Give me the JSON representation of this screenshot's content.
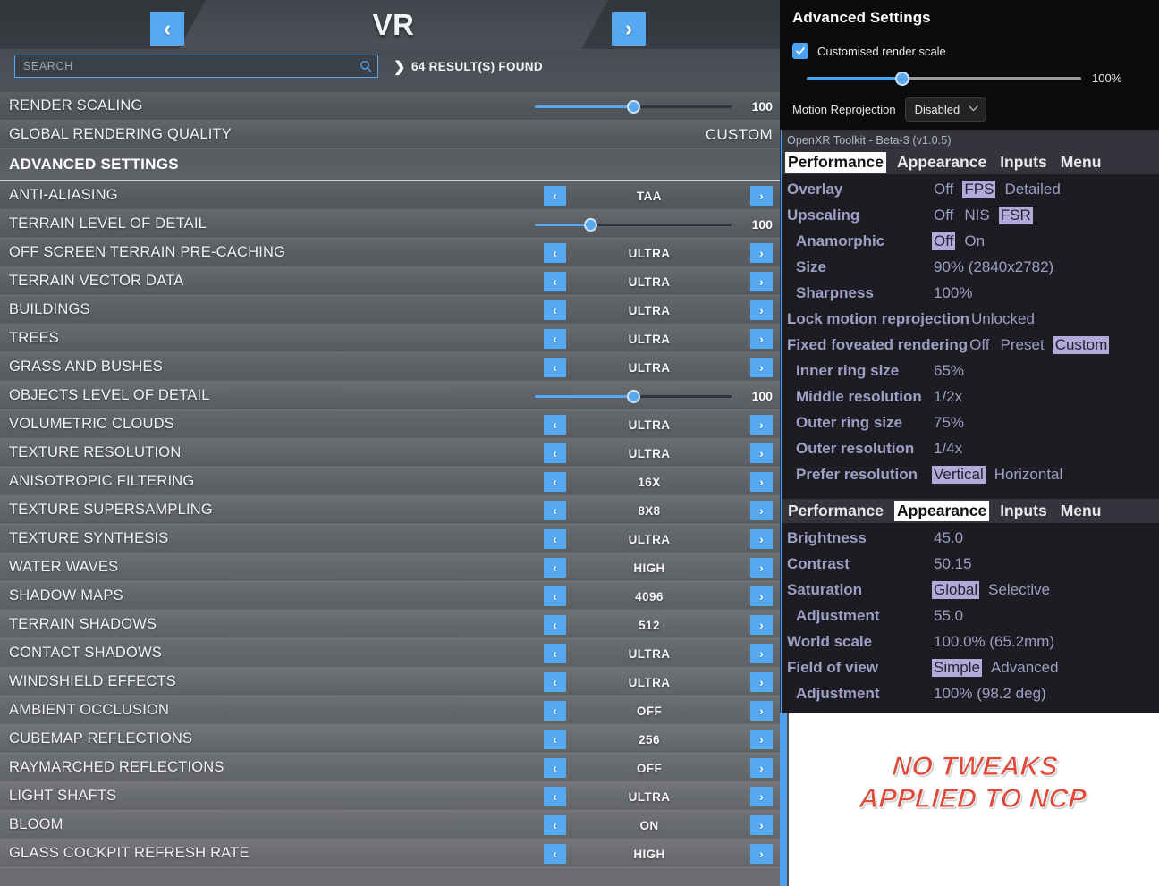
{
  "msfs": {
    "title": "VR",
    "nav": {
      "prev": "‹",
      "next": "›"
    },
    "search": {
      "placeholder": "SEARCH",
      "value": "",
      "icon": "search-icon"
    },
    "results": {
      "arrow": "❯",
      "text": "64 RESULT(S) FOUND"
    },
    "section_header": "ADVANCED SETTINGS",
    "top_rows": [
      {
        "label": "RENDER SCALING",
        "type": "slider",
        "value": "100",
        "fill_pct": 50
      },
      {
        "label": "GLOBAL RENDERING QUALITY",
        "type": "text",
        "value": "CUSTOM"
      }
    ],
    "rows": [
      {
        "label": "ANTI-ALIASING",
        "type": "spinner",
        "value": "TAA"
      },
      {
        "label": "TERRAIN LEVEL OF DETAIL",
        "type": "slider",
        "value": "100",
        "fill_pct": 28
      },
      {
        "label": "OFF SCREEN TERRAIN PRE-CACHING",
        "type": "spinner",
        "value": "ULTRA"
      },
      {
        "label": "TERRAIN VECTOR DATA",
        "type": "spinner",
        "value": "ULTRA"
      },
      {
        "label": "BUILDINGS",
        "type": "spinner",
        "value": "ULTRA"
      },
      {
        "label": "TREES",
        "type": "spinner",
        "value": "ULTRA"
      },
      {
        "label": "GRASS AND BUSHES",
        "type": "spinner",
        "value": "ULTRA"
      },
      {
        "label": "OBJECTS LEVEL OF DETAIL",
        "type": "slider",
        "value": "100",
        "fill_pct": 50
      },
      {
        "label": "VOLUMETRIC CLOUDS",
        "type": "spinner",
        "value": "ULTRA"
      },
      {
        "label": "TEXTURE RESOLUTION",
        "type": "spinner",
        "value": "ULTRA"
      },
      {
        "label": "ANISOTROPIC FILTERING",
        "type": "spinner",
        "value": "16X"
      },
      {
        "label": "TEXTURE SUPERSAMPLING",
        "type": "spinner",
        "value": "8X8"
      },
      {
        "label": "TEXTURE SYNTHESIS",
        "type": "spinner",
        "value": "ULTRA"
      },
      {
        "label": "WATER WAVES",
        "type": "spinner",
        "value": "HIGH"
      },
      {
        "label": "SHADOW MAPS",
        "type": "spinner",
        "value": "4096"
      },
      {
        "label": "TERRAIN SHADOWS",
        "type": "spinner",
        "value": "512"
      },
      {
        "label": "CONTACT SHADOWS",
        "type": "spinner",
        "value": "ULTRA"
      },
      {
        "label": "WINDSHIELD EFFECTS",
        "type": "spinner",
        "value": "ULTRA"
      },
      {
        "label": "AMBIENT OCCLUSION",
        "type": "spinner",
        "value": "OFF"
      },
      {
        "label": "CUBEMAP REFLECTIONS",
        "type": "spinner",
        "value": "256"
      },
      {
        "label": "RAYMARCHED REFLECTIONS",
        "type": "spinner",
        "value": "OFF"
      },
      {
        "label": "LIGHT SHAFTS",
        "type": "spinner",
        "value": "ULTRA"
      },
      {
        "label": "BLOOM",
        "type": "spinner",
        "value": "ON"
      },
      {
        "label": "GLASS COCKPIT REFRESH RATE",
        "type": "spinner",
        "value": "HIGH"
      }
    ],
    "spinner_glyphs": {
      "left": "‹",
      "right": "›"
    }
  },
  "advanced_settings": {
    "title": "Advanced Settings",
    "checkbox": {
      "label": "Customised render scale",
      "checked": true,
      "glyph": "✓"
    },
    "slider": {
      "value_label": "100%",
      "fill_pct": 35
    },
    "motion_reprojection": {
      "label": "Motion Reprojection",
      "value": "Disabled",
      "caret": "⌄"
    }
  },
  "openxr_toolkit": {
    "titlebar": "OpenXR Toolkit - Beta-3 (v1.0.5)",
    "performance": {
      "tabs": [
        {
          "label": "Performance",
          "active": true
        },
        {
          "label": "Appearance",
          "active": false
        },
        {
          "label": "Inputs",
          "active": false
        },
        {
          "label": "Menu",
          "active": false
        }
      ],
      "rows": [
        {
          "label": "Overlay",
          "indent": 0,
          "options": [
            {
              "text": "Off",
              "selected": false
            },
            {
              "text": "FPS",
              "selected": true
            },
            {
              "text": "Detailed",
              "selected": false
            }
          ]
        },
        {
          "label": "Upscaling",
          "indent": 0,
          "options": [
            {
              "text": "Off",
              "selected": false
            },
            {
              "text": "NIS",
              "selected": false
            },
            {
              "text": "FSR",
              "selected": true
            }
          ]
        },
        {
          "label": "Anamorphic",
          "indent": 1,
          "options": [
            {
              "text": "Off",
              "selected": true
            },
            {
              "text": "On",
              "selected": false
            }
          ]
        },
        {
          "label": "Size",
          "indent": 1,
          "options": [
            {
              "text": "90% (2840x2782)",
              "selected": false
            }
          ]
        },
        {
          "label": "Sharpness",
          "indent": 1,
          "options": [
            {
              "text": "100%",
              "selected": false
            }
          ]
        },
        {
          "label": "Lock motion reprojection",
          "indent": 0,
          "options": [
            {
              "text": "Unlocked",
              "selected": false
            }
          ]
        },
        {
          "label": "Fixed foveated rendering",
          "indent": 0,
          "options": [
            {
              "text": "Off",
              "selected": false
            },
            {
              "text": "Preset",
              "selected": false
            },
            {
              "text": "Custom",
              "selected": true
            }
          ]
        },
        {
          "label": "Inner ring size",
          "indent": 1,
          "options": [
            {
              "text": "65%",
              "selected": false
            }
          ]
        },
        {
          "label": "Middle resolution",
          "indent": 1,
          "options": [
            {
              "text": "1/2x",
              "selected": false
            }
          ]
        },
        {
          "label": "Outer ring size",
          "indent": 1,
          "options": [
            {
              "text": "75%",
              "selected": false
            }
          ]
        },
        {
          "label": "Outer resolution",
          "indent": 1,
          "options": [
            {
              "text": "1/4x",
              "selected": false
            }
          ]
        },
        {
          "label": "Prefer resolution",
          "indent": 1,
          "options": [
            {
              "text": "Vertical",
              "selected": true
            },
            {
              "text": "Horizontal",
              "selected": false
            }
          ]
        }
      ]
    },
    "appearance": {
      "tabs": [
        {
          "label": "Performance",
          "active": false
        },
        {
          "label": "Appearance",
          "active": true
        },
        {
          "label": "Inputs",
          "active": false
        },
        {
          "label": "Menu",
          "active": false
        }
      ],
      "rows": [
        {
          "label": "Brightness",
          "indent": 0,
          "options": [
            {
              "text": "45.0",
              "selected": false
            }
          ]
        },
        {
          "label": "Contrast",
          "indent": 0,
          "options": [
            {
              "text": "50.15",
              "selected": false
            }
          ]
        },
        {
          "label": "Saturation",
          "indent": 0,
          "options": [
            {
              "text": "Global",
              "selected": true
            },
            {
              "text": "Selective",
              "selected": false
            }
          ]
        },
        {
          "label": "Adjustment",
          "indent": 1,
          "options": [
            {
              "text": "55.0",
              "selected": false
            }
          ]
        },
        {
          "label": "World scale",
          "indent": 0,
          "options": [
            {
              "text": "100.0% (65.2mm)",
              "selected": false
            }
          ]
        },
        {
          "label": "Field of view",
          "indent": 0,
          "options": [
            {
              "text": "Simple",
              "selected": true
            },
            {
              "text": "Advanced",
              "selected": false
            }
          ]
        },
        {
          "label": "Adjustment",
          "indent": 1,
          "options": [
            {
              "text": "100% (98.2 deg)",
              "selected": false
            }
          ]
        }
      ]
    }
  },
  "ncp_note": {
    "line1": "NO TWEAKS",
    "line2": "APPLIED TO NCP"
  },
  "colors": {
    "accent_blue": "#56a8f0",
    "msfs_panel": "#5f6266",
    "oxr_label": "#9d9fc4",
    "oxr_highlight": "#b0abda",
    "ncp_red": "#e04a3a"
  }
}
